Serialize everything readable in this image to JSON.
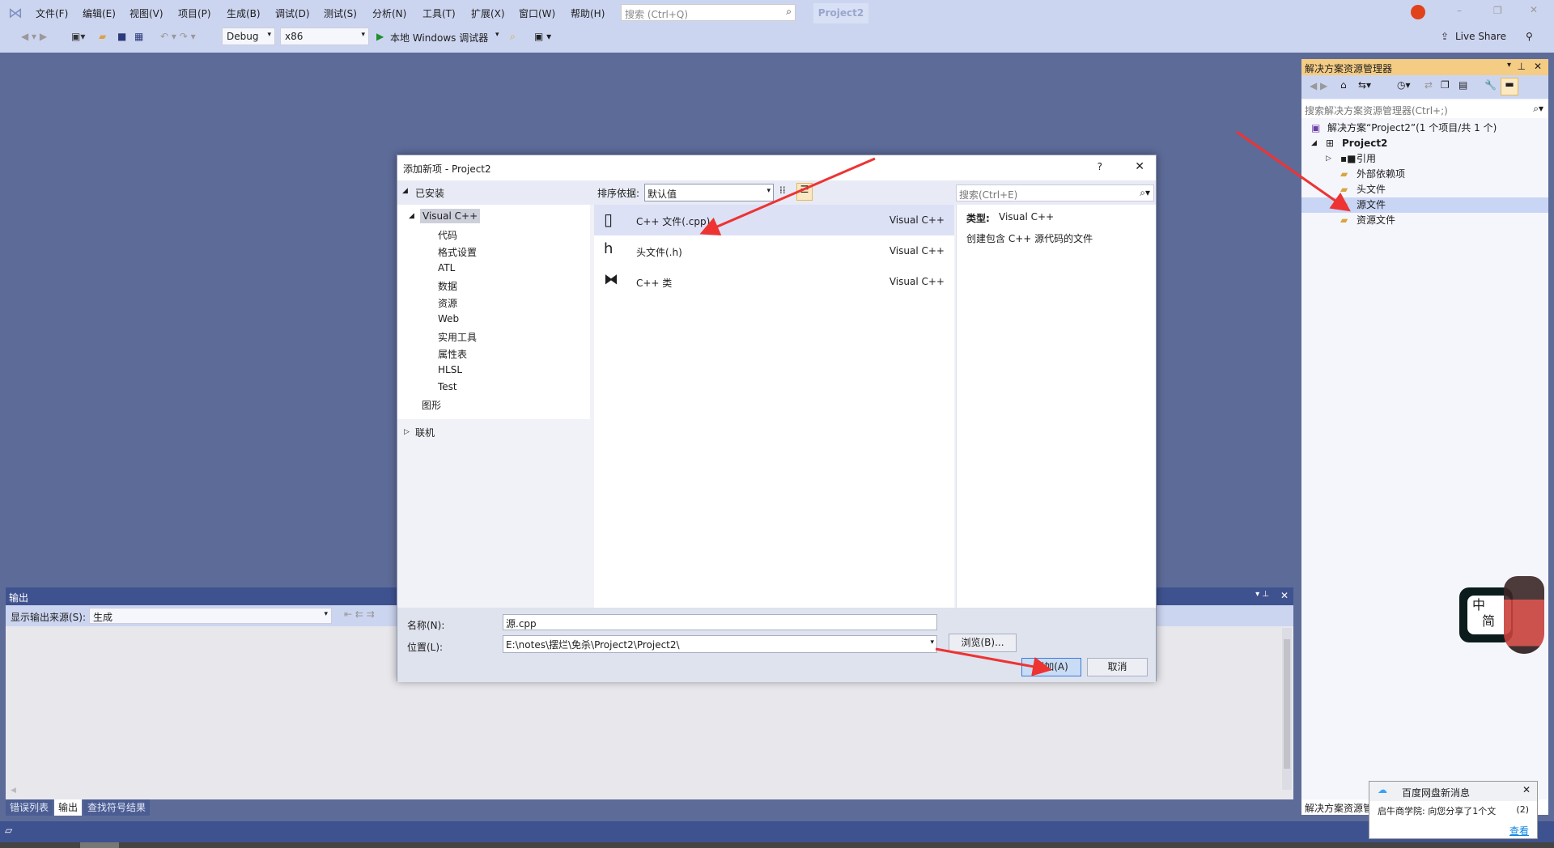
{
  "menu": [
    "文件(F)",
    "编辑(E)",
    "视图(V)",
    "项目(P)",
    "生成(B)",
    "调试(D)",
    "测试(S)",
    "分析(N)",
    "工具(T)",
    "扩展(X)",
    "窗口(W)",
    "帮助(H)"
  ],
  "search_placeholder": "搜索 (Ctrl+Q)",
  "project_badge": "Project2",
  "toolbar": {
    "config": "Debug",
    "platform": "x86",
    "run": "本地 Windows 调试器",
    "live_share": "Live Share"
  },
  "dialog": {
    "title": "添加新项 - Project2",
    "help": "?",
    "installed": "已安装",
    "sort_label": "排序依据:",
    "sort_value": "默认值",
    "search_placeholder": "搜索(Ctrl+E)",
    "tree": [
      "Visual C++",
      "代码",
      "格式设置",
      "ATL",
      "数据",
      "资源",
      "Web",
      "实用工具",
      "属性表",
      "HLSL",
      "Test",
      "图形"
    ],
    "online": "联机",
    "items": [
      {
        "name": "C++ 文件(.cpp)",
        "type": "Visual C++",
        "icon": "cpp-file-icon"
      },
      {
        "name": "头文件(.h)",
        "type": "Visual C++",
        "icon": "header-file-icon"
      },
      {
        "name": "C++ 类",
        "type": "Visual C++",
        "icon": "class-icon"
      }
    ],
    "detail_type_label": "类型:",
    "detail_type": "Visual C++",
    "detail_desc": "创建包含 C++ 源代码的文件",
    "name_label": "名称(N):",
    "name_value": "源.cpp",
    "location_label": "位置(L):",
    "location_value": "E:\\notes\\摆烂\\免杀\\Project2\\Project2\\",
    "browse": "浏览(B)...",
    "add": "添加(A)",
    "cancel": "取消"
  },
  "solution_explorer": {
    "title": "解决方案资源管理器",
    "search_placeholder": "搜索解决方案资源管理器(Ctrl+;)",
    "solution": "解决方案“Project2”(1 个项目/共 1 个)",
    "project": "Project2",
    "nodes": [
      "引用",
      "外部依赖项",
      "头文件",
      "源文件",
      "资源文件"
    ],
    "selected": "源文件",
    "bottom_tab": "解决方案资源管"
  },
  "output": {
    "title": "输出",
    "source_label": "显示输出来源(S):",
    "source_value": "生成"
  },
  "bottom_tabs": [
    "错误列表",
    "输出",
    "查找符号结果"
  ],
  "notification": {
    "title": "百度网盘新消息",
    "body": "启牛商学院: 向您分享了1个文",
    "count": "(2)",
    "link": "查看"
  },
  "ime": {
    "lang": "中",
    "mode": "简"
  },
  "colors": {
    "accent": "#3f5290",
    "highlight": "#c9d5f5",
    "arrow": "#ee3333"
  }
}
